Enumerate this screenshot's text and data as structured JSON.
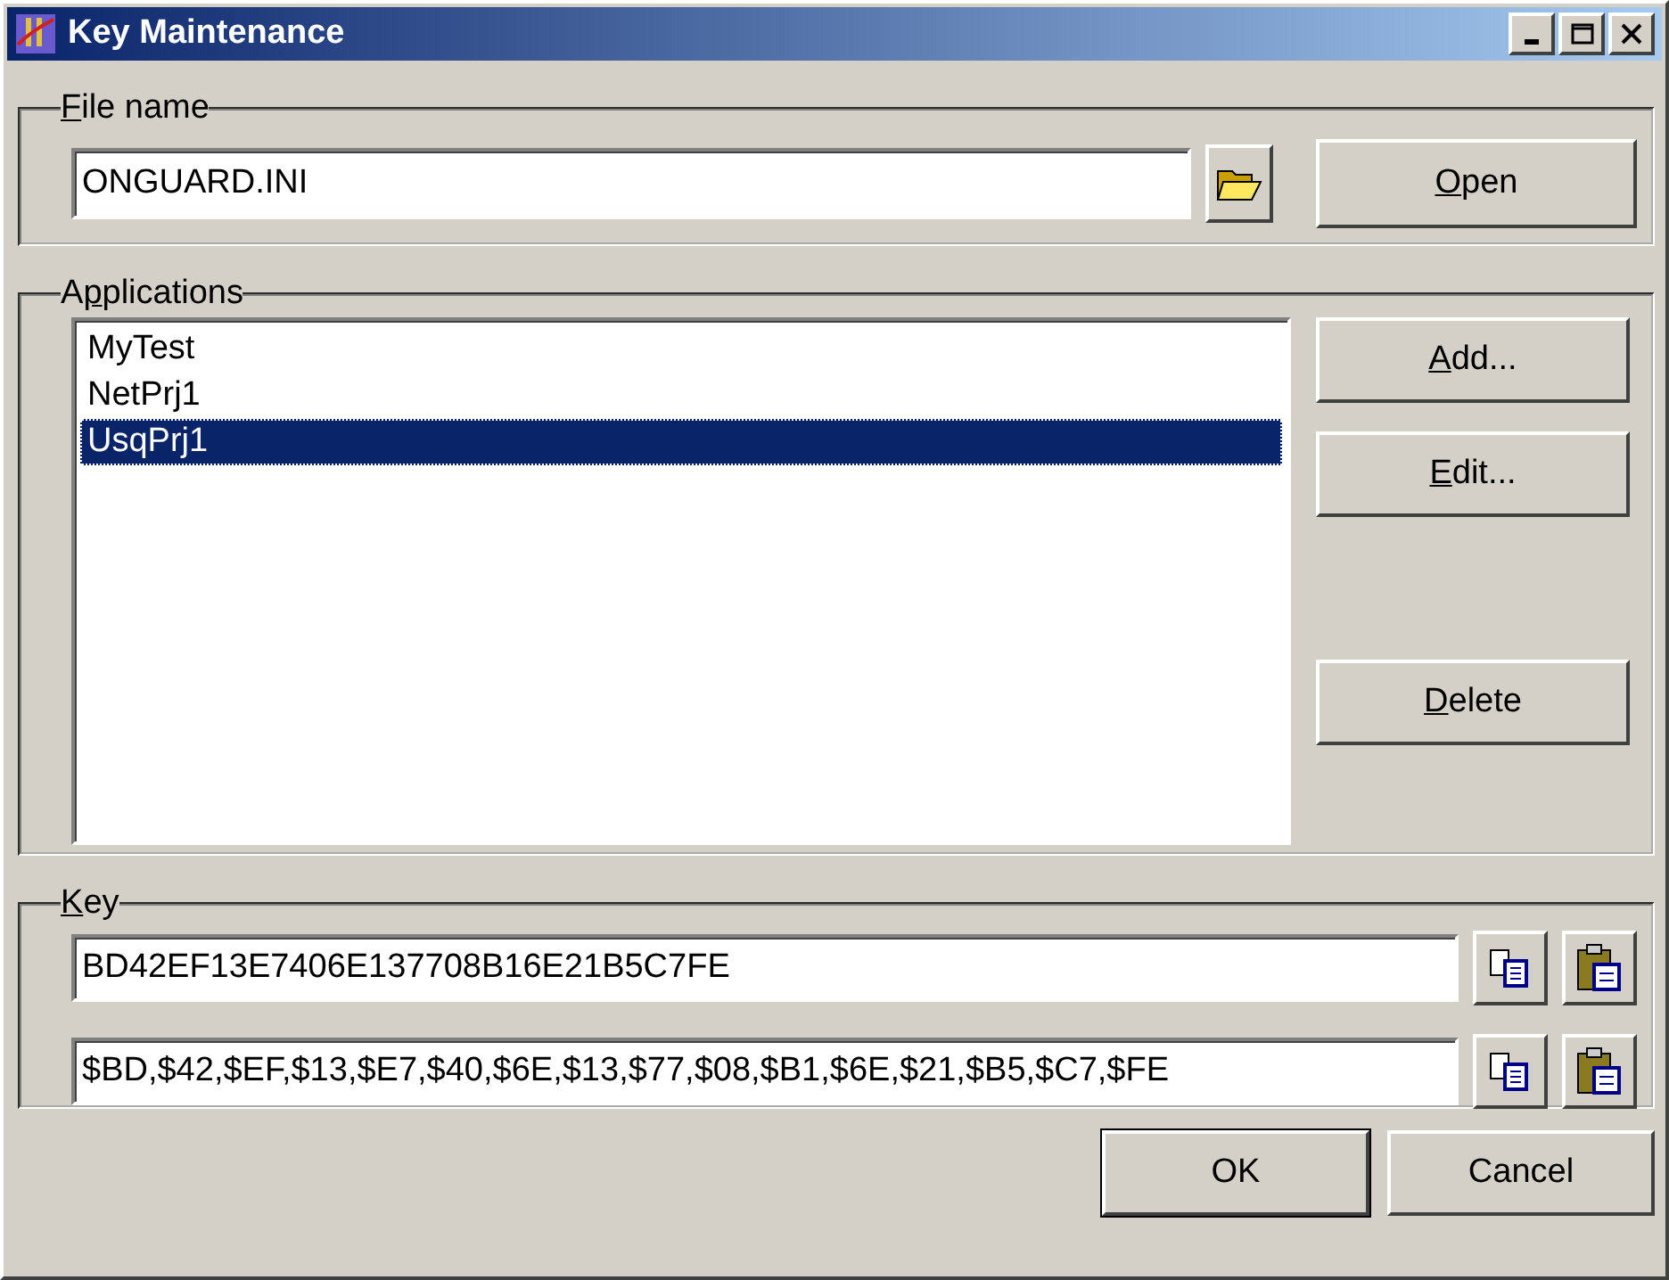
{
  "window": {
    "title": "Key Maintenance",
    "controls": [
      {
        "kind": "minimize"
      },
      {
        "kind": "maximize"
      },
      {
        "kind": "close"
      }
    ]
  },
  "file_group": {
    "label": {
      "key": "F",
      "after": "ile name"
    },
    "value": "ONGUARD.INI",
    "open_button": {
      "key": "O",
      "after": "pen"
    }
  },
  "applications_group": {
    "label": {
      "before": "A",
      "key": "p",
      "after": "plications"
    },
    "items": [
      {
        "label": "MyTest",
        "selected": false
      },
      {
        "label": "NetPrj1",
        "selected": false
      },
      {
        "label": "UsqPrj1",
        "selected": true
      }
    ],
    "buttons": [
      {
        "key": "A",
        "after": "dd..."
      },
      {
        "key": "E",
        "after": "dit..."
      },
      {
        "key": "D",
        "after": "elete"
      }
    ]
  },
  "key_group": {
    "label": {
      "key": "K",
      "after": "ey"
    },
    "values": [
      "BD42EF13E7406E137708B16E21B5C7FE",
      "$BD,$42,$EF,$13,$E7,$40,$6E,$13,$77,$08,$B1,$6E,$21,$B5,$C7,$FE"
    ]
  },
  "footer": {
    "buttons": [
      {
        "label": "OK",
        "default": true
      },
      {
        "label": "Cancel",
        "default": false
      }
    ]
  }
}
